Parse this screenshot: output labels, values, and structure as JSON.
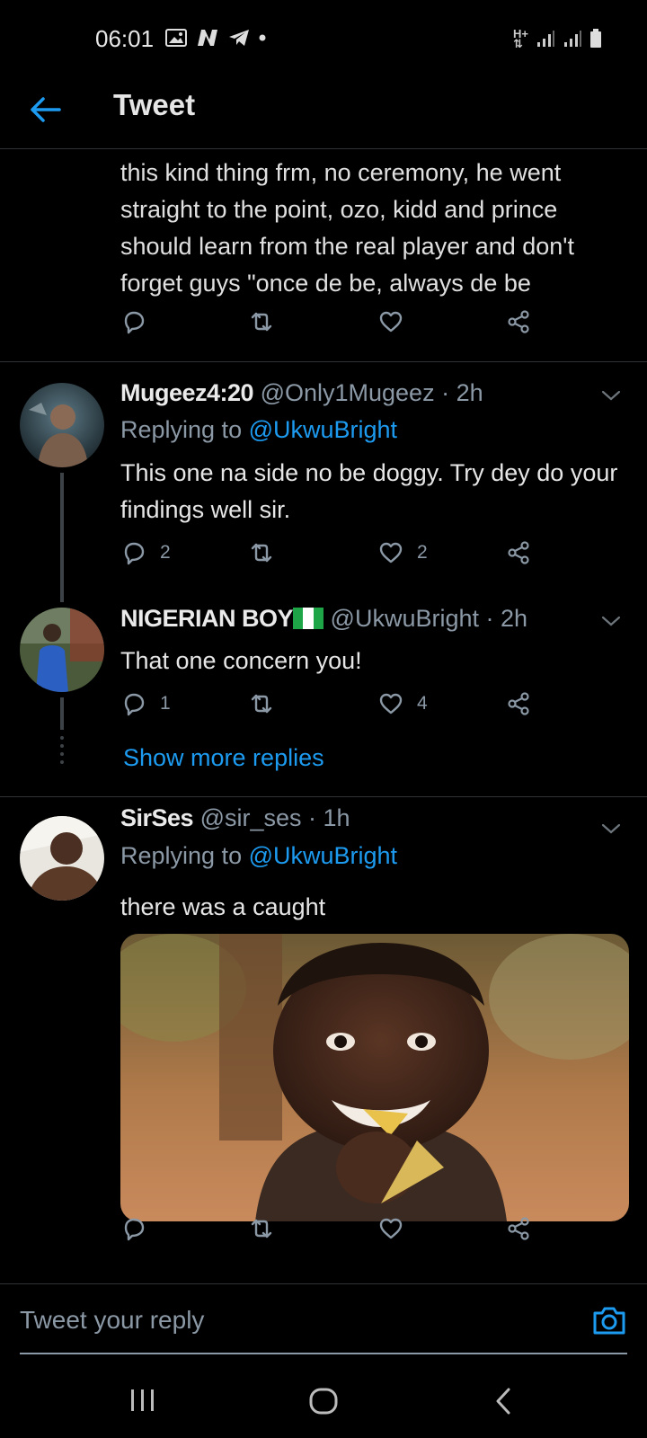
{
  "status_bar": {
    "time": "06:01",
    "network": "H+"
  },
  "header": {
    "title": "Tweet"
  },
  "partial_tweet": {
    "text": "this kind thing frm, no ceremony, he went straight to the point, ozo, kidd and prince should learn from the real player and don't forget guys \"once de be, always de be"
  },
  "replies": [
    {
      "name": "Mugeez4:20",
      "handle": "@Only1Mugeez · 2h",
      "replying_label": "Replying to",
      "replying_to": "@UkwuBright",
      "text": "This one na side no be doggy. Try dey do your findings well sir.",
      "reply_count": "2",
      "like_count": "2"
    },
    {
      "name": "NIGERIAN BOY",
      "handle": "@UkwuBright · 2h",
      "text": "That one concern you!",
      "reply_count": "1",
      "like_count": "4"
    },
    {
      "name": "SirSes",
      "handle": "@sir_ses · 1h",
      "replying_label": "Replying to",
      "replying_to": "@UkwuBright",
      "text": "there was a caught"
    }
  ],
  "show_more": "Show more replies",
  "reply_bar": {
    "placeholder": "Tweet your reply"
  },
  "colors": {
    "accent": "#1d9bf0",
    "muted": "#8b98a5",
    "background": "#000000"
  }
}
